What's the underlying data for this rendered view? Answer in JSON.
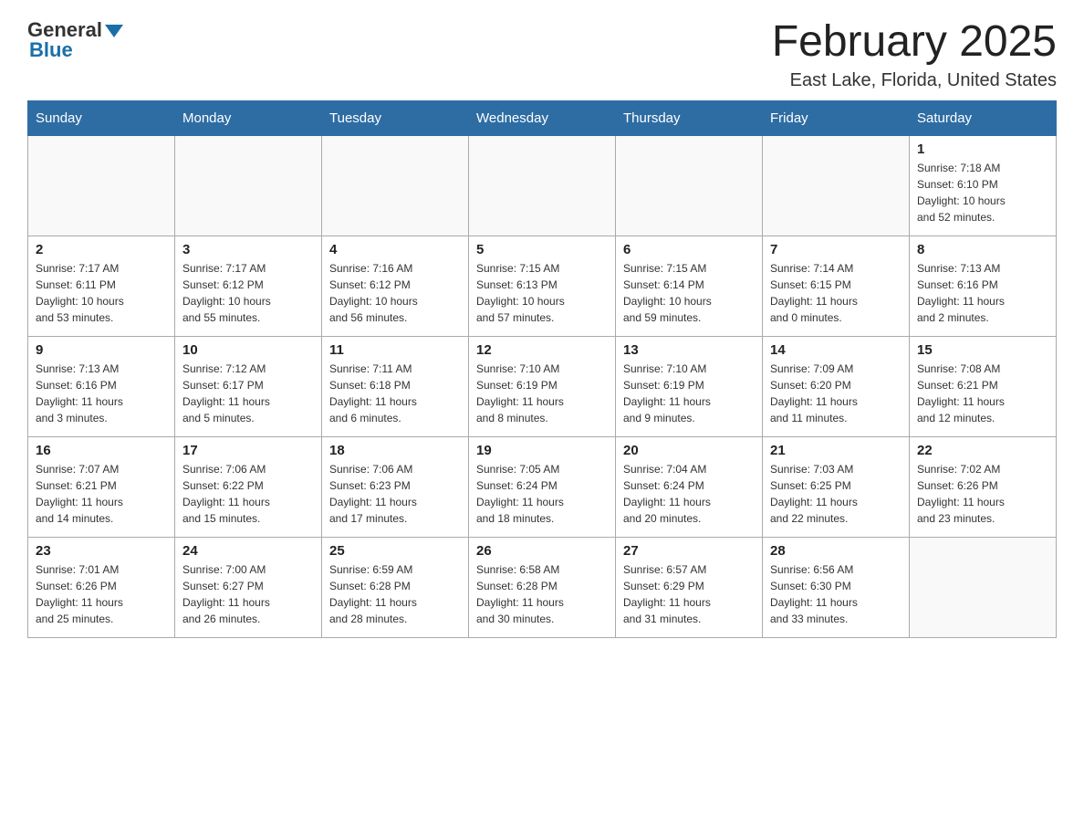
{
  "logo": {
    "general": "General",
    "blue": "Blue"
  },
  "title": "February 2025",
  "subtitle": "East Lake, Florida, United States",
  "days_of_week": [
    "Sunday",
    "Monday",
    "Tuesday",
    "Wednesday",
    "Thursday",
    "Friday",
    "Saturday"
  ],
  "weeks": [
    [
      {
        "day": "",
        "info": ""
      },
      {
        "day": "",
        "info": ""
      },
      {
        "day": "",
        "info": ""
      },
      {
        "day": "",
        "info": ""
      },
      {
        "day": "",
        "info": ""
      },
      {
        "day": "",
        "info": ""
      },
      {
        "day": "1",
        "info": "Sunrise: 7:18 AM\nSunset: 6:10 PM\nDaylight: 10 hours\nand 52 minutes."
      }
    ],
    [
      {
        "day": "2",
        "info": "Sunrise: 7:17 AM\nSunset: 6:11 PM\nDaylight: 10 hours\nand 53 minutes."
      },
      {
        "day": "3",
        "info": "Sunrise: 7:17 AM\nSunset: 6:12 PM\nDaylight: 10 hours\nand 55 minutes."
      },
      {
        "day": "4",
        "info": "Sunrise: 7:16 AM\nSunset: 6:12 PM\nDaylight: 10 hours\nand 56 minutes."
      },
      {
        "day": "5",
        "info": "Sunrise: 7:15 AM\nSunset: 6:13 PM\nDaylight: 10 hours\nand 57 minutes."
      },
      {
        "day": "6",
        "info": "Sunrise: 7:15 AM\nSunset: 6:14 PM\nDaylight: 10 hours\nand 59 minutes."
      },
      {
        "day": "7",
        "info": "Sunrise: 7:14 AM\nSunset: 6:15 PM\nDaylight: 11 hours\nand 0 minutes."
      },
      {
        "day": "8",
        "info": "Sunrise: 7:13 AM\nSunset: 6:16 PM\nDaylight: 11 hours\nand 2 minutes."
      }
    ],
    [
      {
        "day": "9",
        "info": "Sunrise: 7:13 AM\nSunset: 6:16 PM\nDaylight: 11 hours\nand 3 minutes."
      },
      {
        "day": "10",
        "info": "Sunrise: 7:12 AM\nSunset: 6:17 PM\nDaylight: 11 hours\nand 5 minutes."
      },
      {
        "day": "11",
        "info": "Sunrise: 7:11 AM\nSunset: 6:18 PM\nDaylight: 11 hours\nand 6 minutes."
      },
      {
        "day": "12",
        "info": "Sunrise: 7:10 AM\nSunset: 6:19 PM\nDaylight: 11 hours\nand 8 minutes."
      },
      {
        "day": "13",
        "info": "Sunrise: 7:10 AM\nSunset: 6:19 PM\nDaylight: 11 hours\nand 9 minutes."
      },
      {
        "day": "14",
        "info": "Sunrise: 7:09 AM\nSunset: 6:20 PM\nDaylight: 11 hours\nand 11 minutes."
      },
      {
        "day": "15",
        "info": "Sunrise: 7:08 AM\nSunset: 6:21 PM\nDaylight: 11 hours\nand 12 minutes."
      }
    ],
    [
      {
        "day": "16",
        "info": "Sunrise: 7:07 AM\nSunset: 6:21 PM\nDaylight: 11 hours\nand 14 minutes."
      },
      {
        "day": "17",
        "info": "Sunrise: 7:06 AM\nSunset: 6:22 PM\nDaylight: 11 hours\nand 15 minutes."
      },
      {
        "day": "18",
        "info": "Sunrise: 7:06 AM\nSunset: 6:23 PM\nDaylight: 11 hours\nand 17 minutes."
      },
      {
        "day": "19",
        "info": "Sunrise: 7:05 AM\nSunset: 6:24 PM\nDaylight: 11 hours\nand 18 minutes."
      },
      {
        "day": "20",
        "info": "Sunrise: 7:04 AM\nSunset: 6:24 PM\nDaylight: 11 hours\nand 20 minutes."
      },
      {
        "day": "21",
        "info": "Sunrise: 7:03 AM\nSunset: 6:25 PM\nDaylight: 11 hours\nand 22 minutes."
      },
      {
        "day": "22",
        "info": "Sunrise: 7:02 AM\nSunset: 6:26 PM\nDaylight: 11 hours\nand 23 minutes."
      }
    ],
    [
      {
        "day": "23",
        "info": "Sunrise: 7:01 AM\nSunset: 6:26 PM\nDaylight: 11 hours\nand 25 minutes."
      },
      {
        "day": "24",
        "info": "Sunrise: 7:00 AM\nSunset: 6:27 PM\nDaylight: 11 hours\nand 26 minutes."
      },
      {
        "day": "25",
        "info": "Sunrise: 6:59 AM\nSunset: 6:28 PM\nDaylight: 11 hours\nand 28 minutes."
      },
      {
        "day": "26",
        "info": "Sunrise: 6:58 AM\nSunset: 6:28 PM\nDaylight: 11 hours\nand 30 minutes."
      },
      {
        "day": "27",
        "info": "Sunrise: 6:57 AM\nSunset: 6:29 PM\nDaylight: 11 hours\nand 31 minutes."
      },
      {
        "day": "28",
        "info": "Sunrise: 6:56 AM\nSunset: 6:30 PM\nDaylight: 11 hours\nand 33 minutes."
      },
      {
        "day": "",
        "info": ""
      }
    ]
  ]
}
